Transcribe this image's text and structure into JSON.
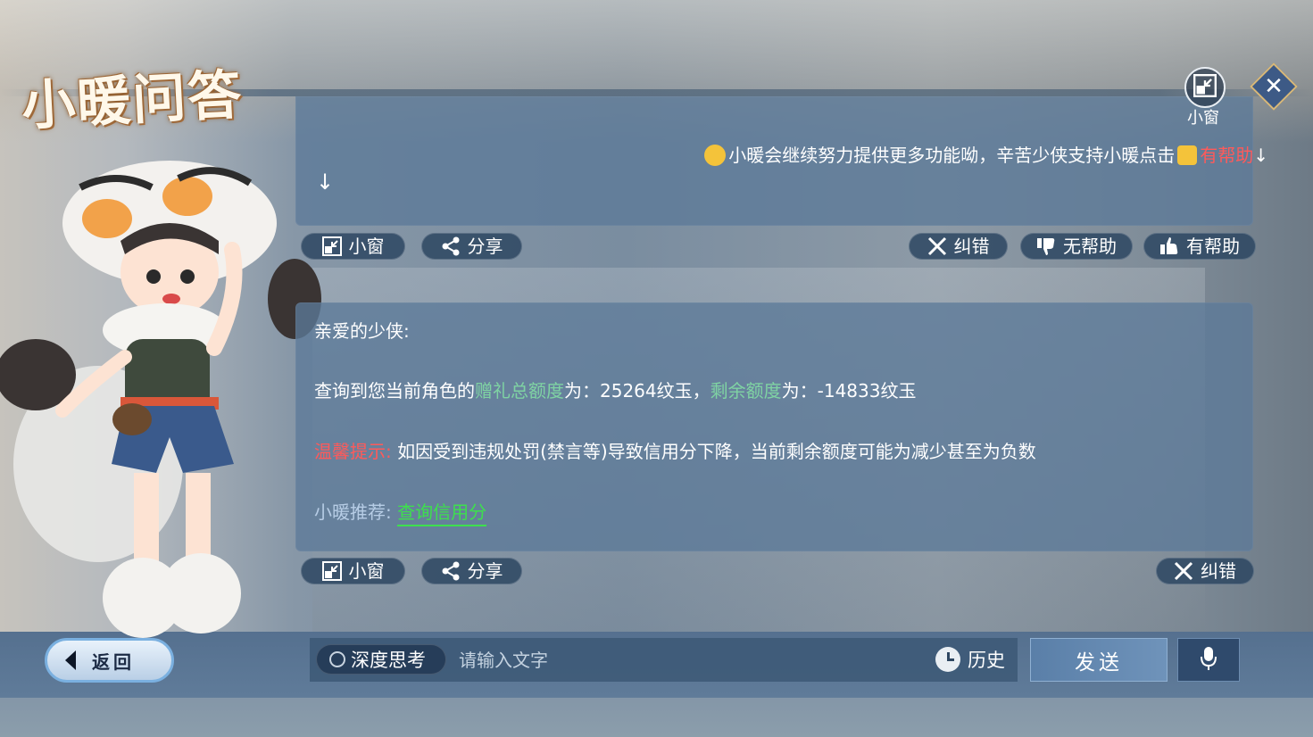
{
  "app": {
    "title": "小暖问答"
  },
  "top_controls": {
    "mini_window_label": "小窗",
    "close_icon": "close-icon"
  },
  "message1": {
    "text_before": "小暖会继续努力提供更多功能呦，辛苦少侠支持小暖点击",
    "highlight": "有帮助",
    "arrow": "↓",
    "arrow2": "↓"
  },
  "message1_actions": {
    "mini_window": "小窗",
    "share": "分享",
    "correct": "纠错",
    "not_helpful": "无帮助",
    "helpful": "有帮助"
  },
  "message2": {
    "greeting": "亲爱的少侠:",
    "query_prefix": "查询到您当前角色的",
    "total_label": "赠礼总额度",
    "total_mid": "为：25264纹玉，",
    "remain_label": "剩余额度",
    "remain_mid": "为：-14833纹玉",
    "tip_label": "温馨提示:",
    "tip_text": "如因受到违规处罚(禁言等)导致信用分下降，当前剩余额度可能为减少甚至为负数",
    "recommend_label": "小暖推荐:",
    "recommend_link": "查询信用分"
  },
  "message2_actions": {
    "mini_window": "小窗",
    "share": "分享",
    "correct": "纠错"
  },
  "bottom": {
    "back": "返回",
    "deep_think": "深度思考",
    "input_placeholder": "请输入文字",
    "history": "历史",
    "send": "发送"
  },
  "colors": {
    "accent_gold": "#e3b45a",
    "highlight_teal": "#7fd3a3",
    "warning_red": "#ff5a5a",
    "link_green": "#3de04d"
  }
}
